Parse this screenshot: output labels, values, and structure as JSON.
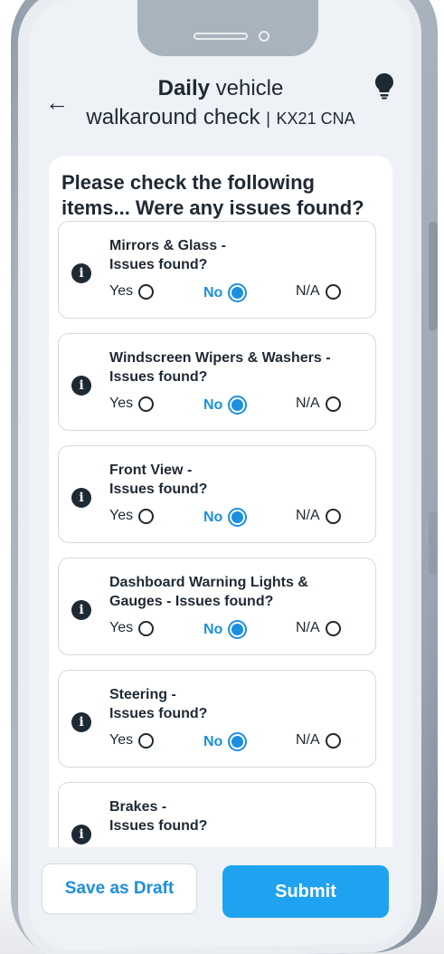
{
  "header": {
    "title_bold": "Daily",
    "title_rest": "vehicle",
    "subtitle": "walkaround check",
    "separator": "|",
    "registration": "KX21 CNA"
  },
  "form": {
    "heading": "Please check the following items... Were any issues found?",
    "options": {
      "yes": "Yes",
      "no": "No",
      "na": "N/A"
    },
    "items": [
      {
        "title_line1": "Mirrors & Glass -",
        "title_line2": "Issues found?",
        "selected": "No"
      },
      {
        "title_line1": "Windscreen Wipers & Washers -",
        "title_line2": "Issues found?",
        "selected": "No"
      },
      {
        "title_line1": "Front View -",
        "title_line2": "Issues found?",
        "selected": "No"
      },
      {
        "title_line1": "Dashboard Warning Lights &",
        "title_line2": "Gauges - Issues found?",
        "selected": "No"
      },
      {
        "title_line1": "Steering -",
        "title_line2": "Issues found?",
        "selected": "No"
      },
      {
        "title_line1": "Brakes -",
        "title_line2": "Issues found?",
        "selected": ""
      }
    ]
  },
  "footer": {
    "save_draft_label": "Save as Draft",
    "submit_label": "Submit"
  },
  "colors": {
    "accent": "#1b8fe0",
    "submit": "#1fa3f0",
    "text": "#1f2933"
  },
  "icons": {
    "back": "arrow-left-icon",
    "bulb": "lightbulb-icon",
    "info": "info-icon"
  }
}
